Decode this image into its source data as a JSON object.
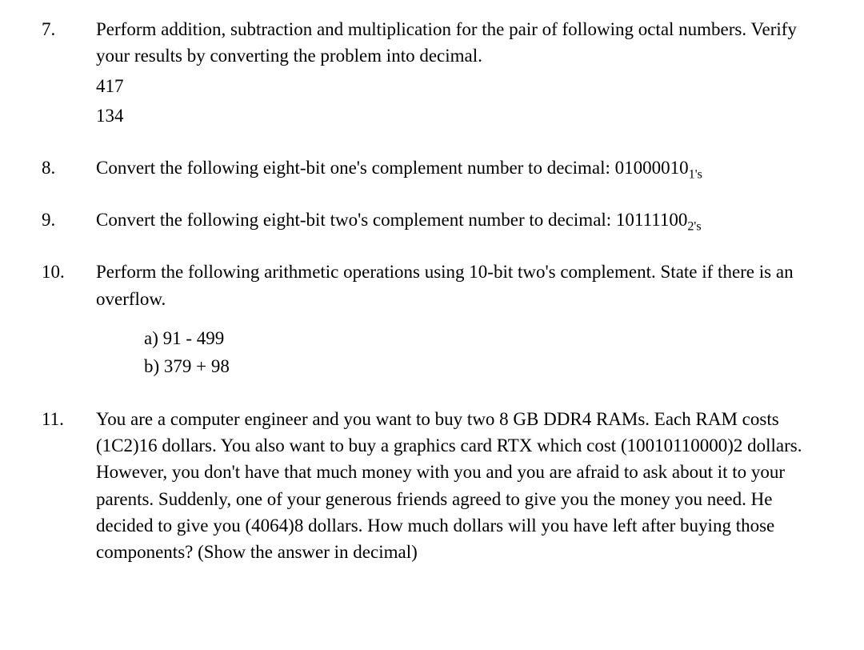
{
  "questions": [
    {
      "number": "7.",
      "lines": [
        "Perform addition, subtraction and multiplication for the pair of following octal numbers. Verify your results by converting the problem into decimal.",
        "417",
        "134"
      ]
    },
    {
      "number": "8.",
      "text_before": "Convert the following eight-bit one's complement number to decimal: 01000010",
      "subscript": "1's"
    },
    {
      "number": "9.",
      "text_before": "Convert the following eight-bit two's complement number to decimal: 10111100",
      "subscript": "2's"
    },
    {
      "number": "10.",
      "text": "Perform the following arithmetic operations using 10-bit two's complement. State if there is an overflow.",
      "sub_items": [
        "a) 91 - 499",
        "b) 379 + 98"
      ]
    },
    {
      "number": "11.",
      "text": "You are a computer engineer and you want to buy two 8 GB DDR4 RAMs. Each RAM costs (1C2)16 dollars. You also want to buy a graphics card RTX which cost (10010110000)2 dollars. However, you don't have that much money with you and you are afraid to ask about it to your parents. Suddenly, one of your generous friends agreed to give you the money you need. He decided to give you (4064)8 dollars. How much dollars will you have left after buying those components? (Show the answer in decimal)"
    }
  ]
}
